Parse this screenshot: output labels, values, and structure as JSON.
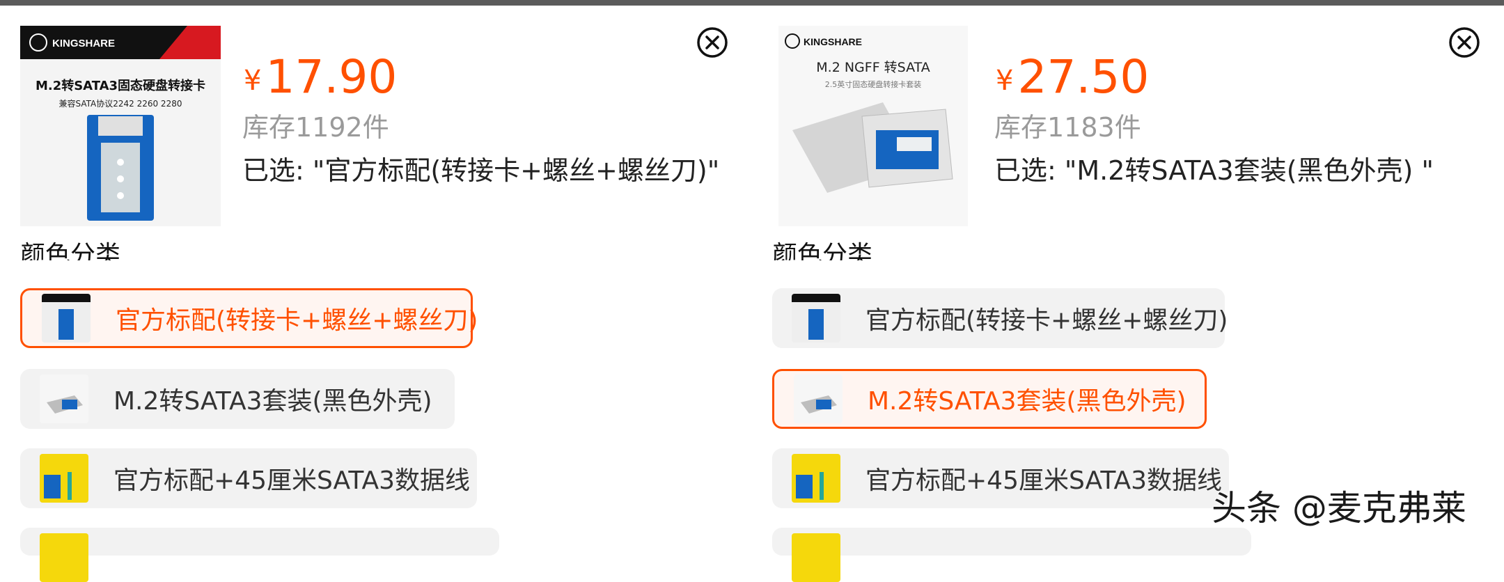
{
  "panels": [
    {
      "brand": "KINGSHARE",
      "image_title": "M.2转SATA3固态硬盘转接卡",
      "image_subtitle": "兼容SATA协议2242 2260 2280",
      "currency": "¥",
      "price": "17.90",
      "stock": "库存1192件",
      "selected": "已选: \"官方标配(转接卡+螺丝+螺丝刀)\"",
      "section_label": "颜色分类",
      "options": [
        {
          "label": "官方标配(转接卡+螺丝+螺丝刀)",
          "selected": true
        },
        {
          "label": "M.2转SATA3套装(黑色外壳)",
          "selected": false
        },
        {
          "label": "官方标配+45厘米SATA3数据线",
          "selected": false
        }
      ]
    },
    {
      "brand": "KINGSHARE",
      "image_title": "M.2 NGFF 转SATA",
      "image_subtitle": "2.5英寸固态硬盘转接卡套装",
      "currency": "¥",
      "price": "27.50",
      "stock": "库存1183件",
      "selected": "已选: \"M.2转SATA3套装(黑色外壳) \"",
      "section_label": "颜色分类",
      "options": [
        {
          "label": "官方标配(转接卡+螺丝+螺丝刀)",
          "selected": false
        },
        {
          "label": "M.2转SATA3套装(黑色外壳)",
          "selected": true
        },
        {
          "label": "官方标配+45厘米SATA3数据线",
          "selected": false
        }
      ]
    }
  ],
  "watermark": "头条 @麦克弗莱",
  "colors": {
    "accent": "#ff5000",
    "option_bg": "#f2f2f2",
    "topbar": "#5b5b5b"
  }
}
